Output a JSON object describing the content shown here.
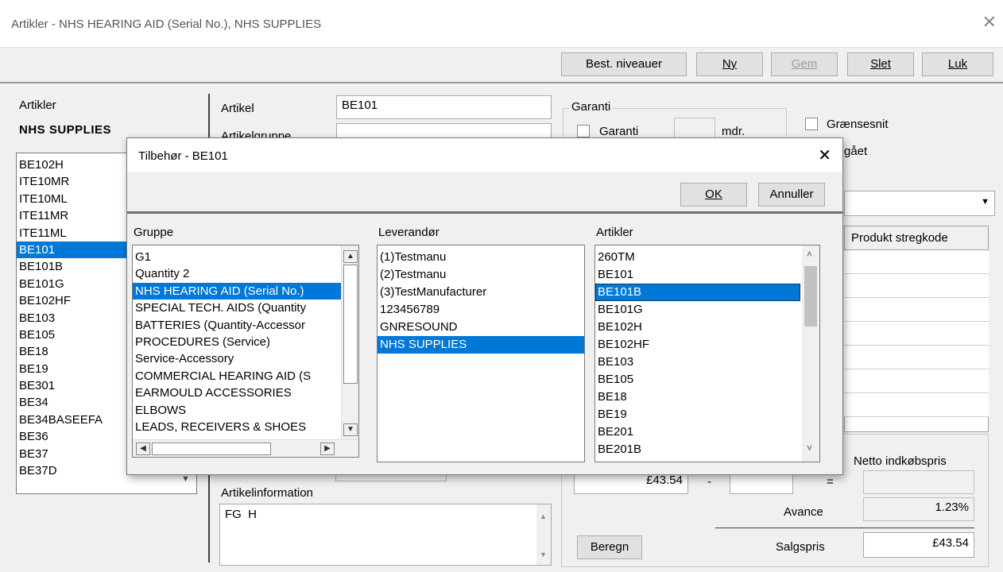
{
  "window": {
    "title": "Artikler - NHS HEARING AID (Serial No.), NHS SUPPLIES",
    "close_glyph": "✕"
  },
  "toolbar": {
    "best_label": "Best. niveauer",
    "ny_label": "Ny",
    "gem_label": "Gem",
    "slet_label": "Slet",
    "luk_label": "Luk"
  },
  "left": {
    "label": "Artikler",
    "supplier": "NHS SUPPLIES",
    "items": [
      "BE102H",
      "ITE10MR",
      "ITE10ML",
      "ITE11MR",
      "ITE11ML",
      "BE101",
      "BE101B",
      "BE101G",
      "BE102HF",
      "BE103",
      "BE105",
      "BE18",
      "BE19",
      "BE301",
      "BE34",
      "BE34BASEEFA",
      "BE36",
      "BE37",
      "BE37D"
    ],
    "selected": "BE101"
  },
  "form": {
    "artikel_label": "Artikel",
    "artikel_value": "BE101",
    "artikelgruppe_label": "Artikelgruppe",
    "garanti_group": "Garanti",
    "garanti_label": "Garanti",
    "mdr_label": "mdr.",
    "graensesnit_label": "Grænsesnit",
    "udgaet_label": "gået",
    "produkt_stregkode": "Produkt stregkode",
    "artikelinformation_label": "Artikelinformation",
    "artikelinformation_value": "FG  H",
    "price_value": "£43.54",
    "minus": "-",
    "equals": "=",
    "netto_label": "Netto indkøbspris",
    "avance_label": "Avance",
    "avance_value": "1.23%",
    "beregn_label": "Beregn",
    "salgspris_label": "Salgspris",
    "salgspris_value": "£43.54"
  },
  "dialog": {
    "title": "Tilbehør - BE101",
    "ok_label": "OK",
    "annuller_label": "Annuller",
    "gruppe_label": "Gruppe",
    "gruppe_items": [
      "G1",
      "Quantity 2",
      "NHS HEARING AID (Serial No.)",
      "SPECIAL TECH. AIDS (Quantity",
      "BATTERIES (Quantity-Accessor",
      "PROCEDURES (Service)",
      "Service-Accessory",
      "COMMERCIAL HEARING AID (S",
      "EARMOULD ACCESSORIES",
      "ELBOWS",
      "LEADS, RECEIVERS & SHOES"
    ],
    "gruppe_selected": "NHS HEARING AID (Serial No.)",
    "leverandor_label": "Leverandør",
    "leverandor_items": [
      "(1)Testmanu",
      "(2)Testmanu",
      "(3)TestManufacturer",
      "123456789",
      "GNRESOUND",
      "NHS SUPPLIES"
    ],
    "leverandor_selected": "NHS SUPPLIES",
    "artikler_label": "Artikler",
    "artikler_items": [
      "260TM",
      "BE101",
      "BE101B",
      "BE101G",
      "BE102H",
      "BE102HF",
      "BE103",
      "BE105",
      "BE18",
      "BE19",
      "BE201",
      "BE201B"
    ],
    "artikler_selected": "BE101B",
    "close_glyph": "✕"
  }
}
